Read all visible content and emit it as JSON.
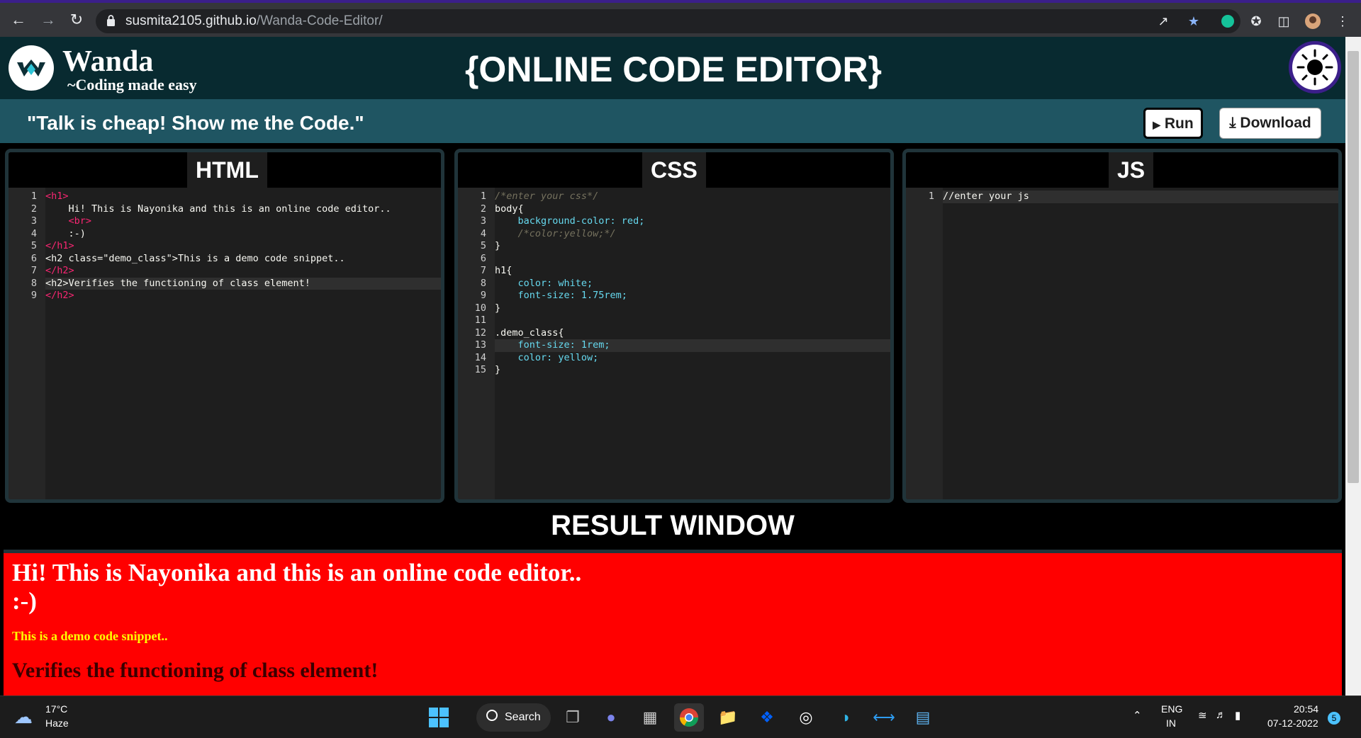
{
  "browser": {
    "url_host": "susmita2105.github.io",
    "url_path": "/Wanda-Code-Editor/",
    "icons": [
      "back-icon",
      "forward-icon",
      "reload-icon",
      "share-icon",
      "star-icon",
      "grammarly-icon",
      "extensions-icon",
      "sidepanel-icon",
      "profile-avatar",
      "menu-icon"
    ]
  },
  "header": {
    "brand": "Wanda",
    "tagline": "~Coding made easy",
    "title": "{ONLINE CODE EDITOR}",
    "quote": "\"Talk is cheap! Show me the Code.\"",
    "run_label": "Run",
    "download_label": "Download"
  },
  "panels": {
    "html": {
      "label": "HTML",
      "lines": [
        "<h1>",
        "    Hi! This is Nayonika and this is an online code editor..",
        "    <br>",
        "    :-)",
        "</h1>",
        "<h2 class=\"demo_class\">This is a demo code snippet..",
        "</h2>",
        "<h2>Verifies the functioning of class element!",
        "</h2>"
      ]
    },
    "css": {
      "label": "CSS",
      "lines": [
        "/*enter your css*/",
        "body{",
        "    background-color: red;",
        "    /*color:yellow;*/",
        "}",
        "",
        "h1{",
        "    color: white;",
        "    font-size: 1.75rem;",
        "}",
        "",
        ".demo_class{",
        "    font-size: 1rem;",
        "    color: yellow;",
        "}"
      ]
    },
    "js": {
      "label": "JS",
      "lines": [
        "//enter your js"
      ]
    }
  },
  "result": {
    "title": "RESULT WINDOW",
    "h1_line1": "Hi! This is Nayonika and this is an online code editor..",
    "h1_line2": ":-)",
    "demo": "This is a demo code snippet..",
    "verifies": "Verifies the functioning of class element!"
  },
  "taskbar": {
    "temp": "17°C",
    "weather": "Haze",
    "search_label": "Search",
    "lang1": "ENG",
    "lang2": "IN",
    "time": "20:54",
    "date": "07-12-2022",
    "badge": "5"
  }
}
